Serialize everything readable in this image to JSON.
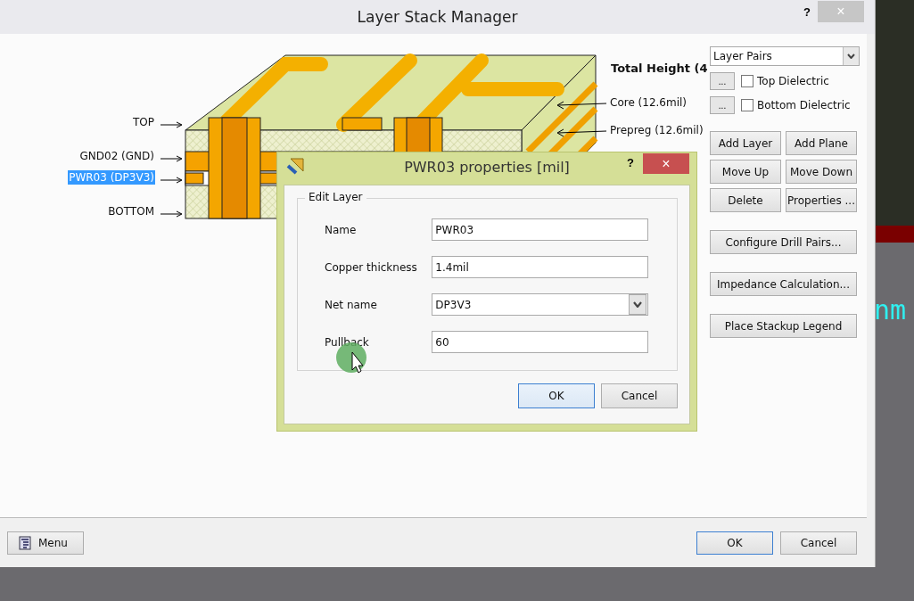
{
  "window": {
    "title": "Layer Stack Manager",
    "help": "?",
    "close": "×"
  },
  "stack_drawing": {
    "layer_labels": [
      {
        "label": "TOP",
        "selected": false
      },
      {
        "label": "GND02 (GND)",
        "selected": false
      },
      {
        "label": "PWR03 (DP3V3)",
        "selected": true
      },
      {
        "label": "BOTTOM",
        "selected": false
      }
    ],
    "total_height": "Total Height (4",
    "dielectric_labels": [
      "Core (12.6mil)",
      "Prepreg (12.6mil)"
    ]
  },
  "side_panel": {
    "view_dropdown": "Layer Pairs",
    "dielectric_options": [
      {
        "button": "...",
        "label": "Top Dielectric",
        "checked": false
      },
      {
        "button": "...",
        "label": "Bottom Dielectric",
        "checked": false
      }
    ],
    "layer_buttons": [
      "Add Layer",
      "Add Plane",
      "Move Up",
      "Move Down",
      "Delete",
      "Properties ..."
    ],
    "action_buttons": [
      "Configure Drill Pairs...",
      "Impedance Calculation...",
      "Place Stackup Legend"
    ]
  },
  "footer": {
    "menu_button": "Menu",
    "buttons": [
      {
        "label": "OK",
        "default": true
      },
      {
        "label": "Cancel",
        "default": false
      }
    ]
  },
  "dialog": {
    "title": "PWR03 properties [mil]",
    "help": "?",
    "close": "×",
    "group_title": "Edit Layer",
    "fields": [
      {
        "label": "Name",
        "value": "PWR03",
        "kind": "text"
      },
      {
        "label": "Copper thickness",
        "value": "1.4mil",
        "kind": "text"
      },
      {
        "label": "Net name",
        "value": "DP3V3",
        "kind": "dropdown"
      },
      {
        "label": "Pullback",
        "value": "60",
        "kind": "text"
      }
    ],
    "buttons": [
      {
        "label": "OK",
        "default": true
      },
      {
        "label": "Cancel",
        "default": false
      }
    ]
  },
  "background": {
    "text": "nm"
  }
}
